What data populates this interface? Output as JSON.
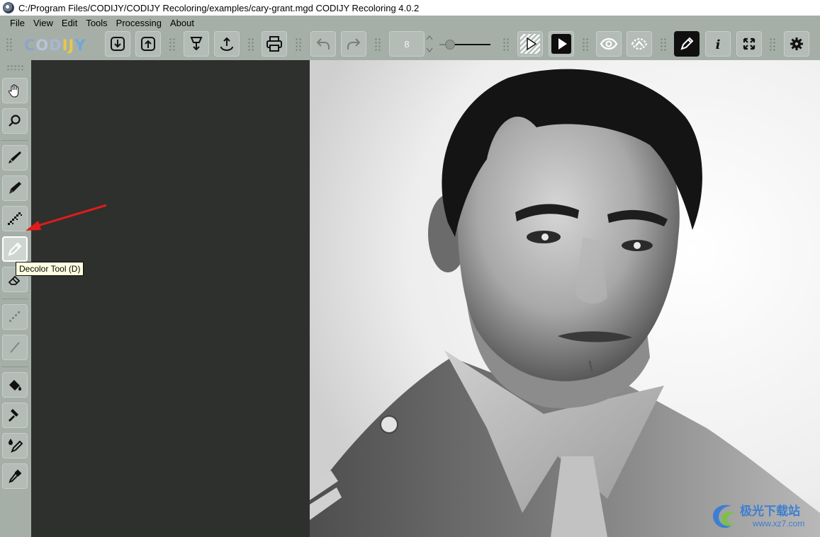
{
  "window": {
    "title": "C:/Program Files/CODIJY/CODIJY Recoloring/examples/cary-grant.mgd CODIJY Recoloring 4.0.2",
    "app_icon": "codijy-app-icon"
  },
  "menu": [
    "File",
    "View",
    "Edit",
    "Tools",
    "Processing",
    "About"
  ],
  "logo": {
    "letters": [
      {
        "char": "C",
        "color": "#8fa3c7"
      },
      {
        "char": "O",
        "color": "#b8c2d9"
      },
      {
        "char": "D",
        "color": "#a9b6d1"
      },
      {
        "char": "I",
        "color": "#e6c84a"
      },
      {
        "char": "J",
        "color": "#e6c84a"
      },
      {
        "char": "Y",
        "color": "#6fa6d9"
      }
    ]
  },
  "toolbar": {
    "buttons": [
      {
        "name": "import-button",
        "icon": "import-icon"
      },
      {
        "name": "export-button",
        "icon": "export-icon"
      },
      {
        "name": "load-palette-button",
        "icon": "load-palette-icon"
      },
      {
        "name": "save-palette-button",
        "icon": "save-palette-icon"
      },
      {
        "name": "print-button",
        "icon": "print-icon"
      },
      {
        "name": "undo-button",
        "icon": "undo-icon",
        "enabled": false
      },
      {
        "name": "redo-button",
        "icon": "redo-icon",
        "enabled": false
      },
      {
        "name": "show-original-button",
        "icon": "striped-play-icon"
      },
      {
        "name": "colorize-button",
        "icon": "play-icon"
      },
      {
        "name": "preview-button",
        "icon": "eye-icon"
      },
      {
        "name": "hide-strokes-button",
        "icon": "strokes-icon"
      },
      {
        "name": "edit-strokes-button",
        "icon": "pencil-icon"
      },
      {
        "name": "info-button",
        "icon": "info-icon"
      },
      {
        "name": "fit-screen-button",
        "icon": "expand-icon"
      },
      {
        "name": "settings-button",
        "icon": "gear-icon"
      }
    ],
    "brush_size": "8",
    "brush_slider_level": 0.2
  },
  "tools": [
    {
      "name": "hand-tool",
      "icon": "hand-icon"
    },
    {
      "name": "zoom-tool",
      "icon": "magnifier-icon"
    },
    {
      "name": "brush-tool",
      "icon": "brush-icon"
    },
    {
      "name": "marker-tool",
      "icon": "marker-icon"
    },
    {
      "name": "dotted-brush-tool",
      "icon": "dotted-brush-icon"
    },
    {
      "name": "decolor-tool",
      "icon": "decolor-pencil-icon",
      "active": true
    },
    {
      "name": "eraser-tool",
      "icon": "eraser-icon"
    },
    {
      "name": "disabled-dotted-tool",
      "icon": "dotted-line-icon",
      "enabled": false
    },
    {
      "name": "disabled-line-tool",
      "icon": "line-icon",
      "enabled": false
    },
    {
      "name": "fill-tool",
      "icon": "bucket-icon"
    },
    {
      "name": "stamp-tool",
      "icon": "hammer-icon"
    },
    {
      "name": "color-picker-tool",
      "icon": "drops-eyedropper-icon"
    },
    {
      "name": "eyedropper-tool",
      "icon": "eyedropper-icon"
    }
  ],
  "tooltip": {
    "text": "Decolor Tool (D)"
  },
  "annotation": {
    "color": "#e21b1b"
  },
  "watermark": {
    "text": "极光下载站",
    "url": "www.xz7.com"
  }
}
